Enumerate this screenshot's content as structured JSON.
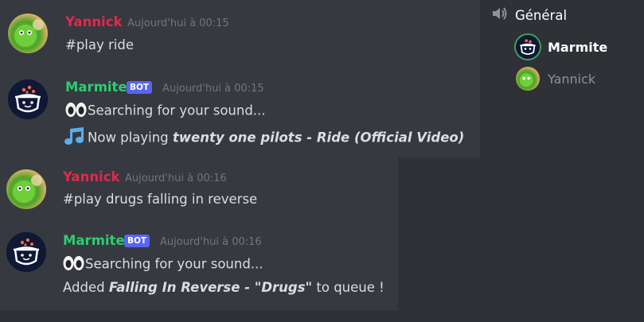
{
  "messages": [
    {
      "author": "Yannick",
      "is_bot": false,
      "timestamp": "Aujourd'hui à 00:15",
      "lines": [
        "#play ride"
      ]
    },
    {
      "author": "Marmite",
      "is_bot": true,
      "bot_badge": "BOT",
      "timestamp": "Aujourd'hui à 00:15",
      "lines": [
        {
          "prefix": "Searching for your sound...",
          "icon": "eyes-emoji"
        },
        {
          "prefix": "Now playing ",
          "bold": "twenty one pilots - Ride (Official Video)",
          "icon": "musical-note-emoji"
        }
      ]
    },
    {
      "author": "Yannick",
      "is_bot": false,
      "timestamp": "Aujourd'hui à 00:16",
      "lines": [
        "#play drugs falling in reverse"
      ]
    },
    {
      "author": "Marmite",
      "is_bot": true,
      "bot_badge": "BOT",
      "timestamp": "Aujourd'hui à 00:16",
      "lines": [
        {
          "prefix": "Searching for your sound...",
          "icon": "eyes-emoji"
        },
        {
          "prefix": "Added ",
          "bold": "Falling In Reverse - \"Drugs\"",
          "suffix": " to queue !"
        }
      ]
    }
  ],
  "voice_channel": {
    "name": "Général",
    "icon": "speaker-icon",
    "members": [
      {
        "name": "Marmite",
        "active": true
      },
      {
        "name": "Yannick",
        "active": false
      }
    ]
  },
  "colors": {
    "background": "#2f3136",
    "chat_background": "#36393f",
    "yannick": "#e0294f",
    "marmite": "#2ecc71",
    "bot_badge": "#5865f2",
    "timestamp": "#72767d",
    "text": "#dcddde"
  }
}
